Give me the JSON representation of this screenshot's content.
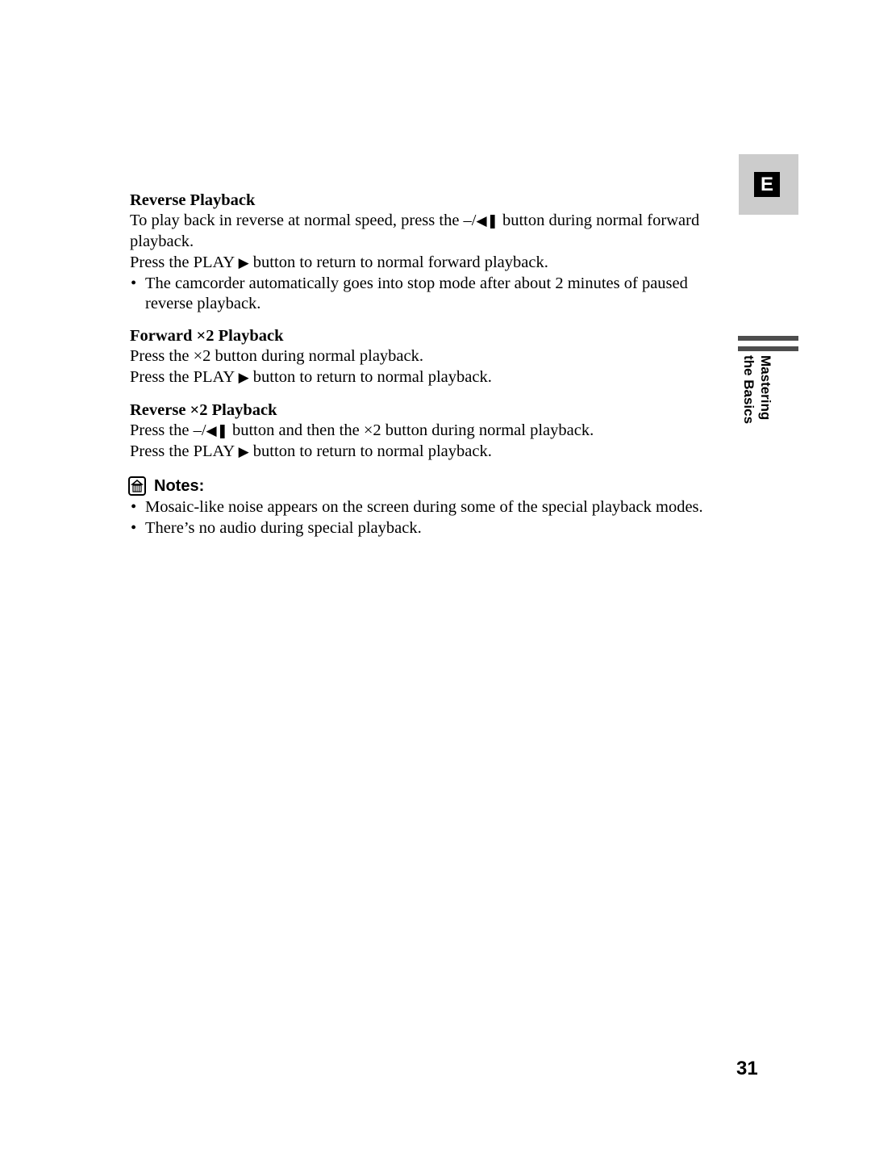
{
  "sections": [
    {
      "heading": "Reverse Playback",
      "line1_a": "To play back in reverse at normal speed, press the –/",
      "line1_icon": "◀❚",
      "line1_b": " button during normal forward playback.",
      "line2_a": "Press the PLAY ",
      "line2_icon": "▶",
      "line2_b": " button to return to normal forward playback.",
      "bullet": "The camcorder automatically goes into stop mode after about 2 minutes of paused reverse playback."
    },
    {
      "heading": "Forward ×2 Playback",
      "line1": "Press the ×2 button during normal playback.",
      "line2_a": "Press the PLAY ",
      "line2_icon": "▶",
      "line2_b": " button to return to normal playback."
    },
    {
      "heading": "Reverse ×2 Playback",
      "line1_a": "Press the –/",
      "line1_icon": "◀❚",
      "line1_b": " button and then the ×2 button during normal playback.",
      "line2_a": "Press the PLAY ",
      "line2_icon": "▶",
      "line2_b": " button to return to normal playback."
    }
  ],
  "notes": {
    "icon": "notes-icon",
    "label": "Notes:",
    "items": [
      "Mosaic-like noise appears on the screen during some of the special playback modes.",
      "There’s no audio during special playback."
    ]
  },
  "side_tab": {
    "letter": "E",
    "chapter_line1": "Mastering",
    "chapter_line2": "the Basics"
  },
  "page_number": "31"
}
